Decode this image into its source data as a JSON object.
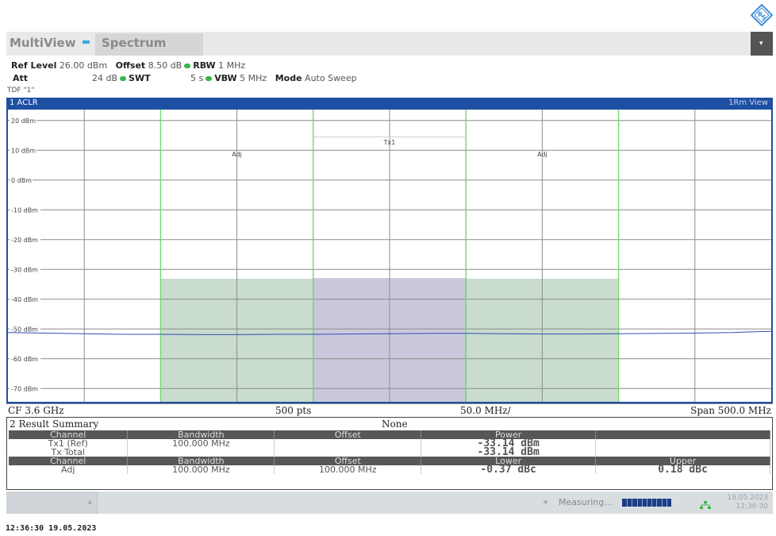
{
  "app": {
    "title": "MultiView",
    "tab": "Spectrum",
    "menu_glyph": "▾"
  },
  "settings": {
    "ref_level_label": "Ref Level",
    "ref_level": "26.00 dBm",
    "offset_label": "Offset",
    "offset": "8.50 dB",
    "rbw_label": "RBW",
    "rbw": "1 MHz",
    "att_label": "Att",
    "att": "24 dB",
    "swt_label": "SWT",
    "swt": "5 s",
    "vbw_label": "VBW",
    "vbw": "5 MHz",
    "mode_label": "Mode",
    "mode": "Auto Sweep",
    "tdf": "TDF \"1\""
  },
  "panel": {
    "title": "1 ACLR",
    "view": "1Rm View"
  },
  "chart_data": {
    "type": "line",
    "y_unit": "dBm",
    "ylim": [
      -75,
      25
    ],
    "y_ticks": [
      20,
      10,
      0,
      -10,
      -20,
      -30,
      -40,
      -50,
      -60,
      -70
    ],
    "y_tick_labels": [
      "20 dBm",
      "10 dBm",
      "0 dBm",
      "-10 dBm",
      "-20 dBm",
      "-30 dBm",
      "-40 dBm",
      "-50 dBm",
      "-60 dBm",
      "-70 dBm"
    ],
    "x_unit": "MHz offset from CF",
    "xlim": [
      -250,
      250
    ],
    "grid": true,
    "channels": [
      {
        "label": "Adj",
        "x_range": [
          -150,
          -50
        ],
        "power": -33.14,
        "color": "#c9dccd"
      },
      {
        "label": "Tx1",
        "x_range": [
          -50,
          50
        ],
        "power": -32.9,
        "color": "#cac8dd"
      },
      {
        "label": "Adj",
        "x_range": [
          50,
          150
        ],
        "power": -33.14,
        "color": "#c9dccd"
      }
    ],
    "channel_label_levels": [
      {
        "label": "Adj",
        "x": -100,
        "y": 8
      },
      {
        "label": "Tx1",
        "x": 0,
        "y": 12
      },
      {
        "label": "Adj",
        "x": 100,
        "y": 8
      }
    ],
    "tx_limit_line": {
      "x_range": [
        -50,
        50
      ],
      "y": 14.5
    },
    "series": [
      {
        "color": "#2e4fb8",
        "x": [
          -250,
          -225,
          -200,
          -175,
          -150,
          -125,
          -100,
          -75,
          -50,
          -25,
          0,
          25,
          50,
          75,
          100,
          125,
          150,
          175,
          200,
          225,
          235,
          250
        ],
        "y": [
          -51.2,
          -51.4,
          -51.6,
          -51.8,
          -51.8,
          -51.9,
          -51.9,
          -51.8,
          -51.8,
          -51.7,
          -51.6,
          -51.5,
          -51.5,
          -51.6,
          -51.7,
          -51.7,
          -51.6,
          -51.5,
          -51.4,
          -51.2,
          -51.0,
          -50.8
        ]
      }
    ]
  },
  "axis": {
    "cf": "CF 3.6 GHz",
    "pts": "500 pts",
    "div": "50.0 MHz/",
    "span": "Span 500.0 MHz"
  },
  "results": {
    "title": "2 Result Summary",
    "none": "None",
    "header1": [
      "Channel",
      "Bandwidth",
      "Offset",
      "Power",
      ""
    ],
    "rows1": [
      [
        "Tx1 (Ref)",
        "100.000 MHz",
        "",
        "-33.14 dBm",
        ""
      ],
      [
        "Tx Total",
        "",
        "",
        "-33.14 dBm",
        ""
      ]
    ],
    "header2": [
      "Channel",
      "Bandwidth",
      "Offset",
      "Lower",
      "Upper"
    ],
    "rows2": [
      [
        "Adj",
        "100.000 MHz",
        "100.000 MHz",
        "-0.37 dBc",
        "0.18 dBc"
      ]
    ]
  },
  "status": {
    "measuring": "Measuring...",
    "date": "19.05.2023",
    "time": "12:36:30",
    "progress_fraction": 1.0
  },
  "footer": {
    "timestamp": "12:36:30  19.05.2023"
  }
}
